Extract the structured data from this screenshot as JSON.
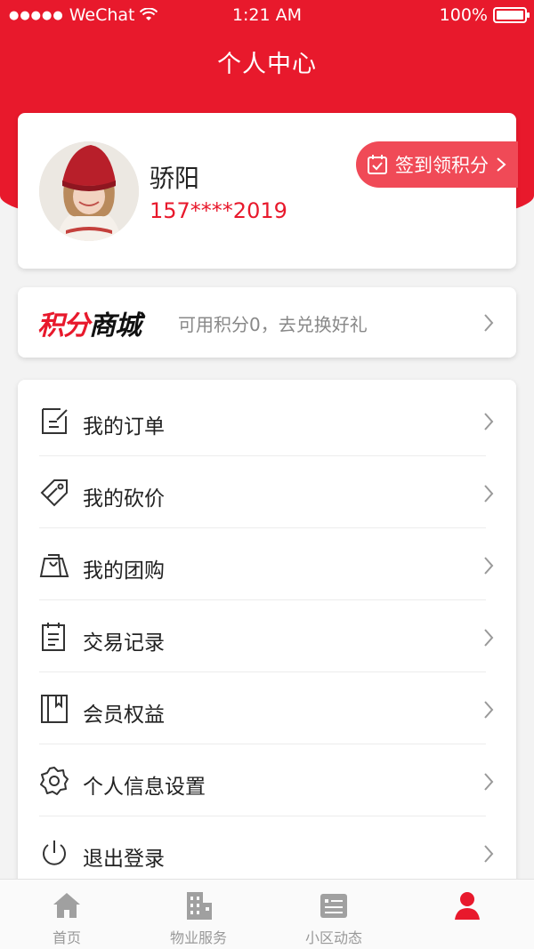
{
  "status_bar": {
    "carrier": "WeChat",
    "time": "1:21 AM",
    "battery": "100%"
  },
  "header": {
    "title": "个人中心"
  },
  "profile": {
    "name": "骄阳",
    "phone": "157****2019",
    "checkin_label": "签到领积分"
  },
  "points": {
    "logo_part1": "积分",
    "logo_part2": "商城",
    "text": "可用积分0，去兑换好礼"
  },
  "menu": [
    {
      "label": "我的订单",
      "icon": "order-icon"
    },
    {
      "label": "我的砍价",
      "icon": "bargain-tag-icon"
    },
    {
      "label": "我的团购",
      "icon": "group-buy-bag-icon"
    },
    {
      "label": "交易记录",
      "icon": "transaction-record-icon"
    },
    {
      "label": "会员权益",
      "icon": "membership-book-icon"
    },
    {
      "label": "个人信息设置",
      "icon": "gear-icon"
    },
    {
      "label": "退出登录",
      "icon": "power-icon"
    }
  ],
  "tabs": [
    {
      "label": "首页",
      "icon": "home-icon"
    },
    {
      "label": "物业服务",
      "icon": "building-icon"
    },
    {
      "label": "小区动态",
      "icon": "news-icon"
    },
    {
      "label": "",
      "icon": "profile-icon"
    }
  ],
  "colors": {
    "accent": "#e8192c",
    "checkin_bg": "#f04a57",
    "page_bg": "#f3f3f3"
  }
}
